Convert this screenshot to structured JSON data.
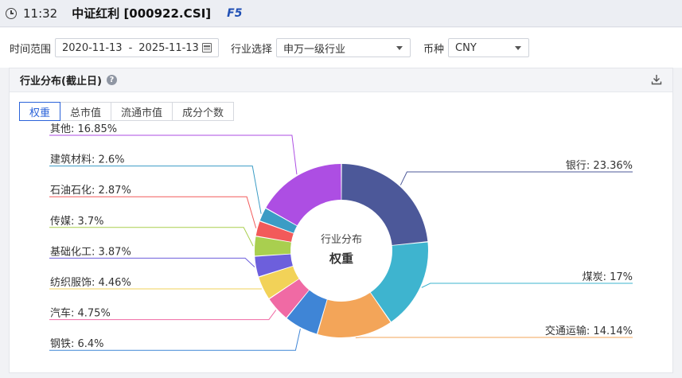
{
  "header": {
    "time": "11:32",
    "security": "中证红利 [000922.CSI]",
    "hotkey": "F5"
  },
  "filters": {
    "date_label": "时间范围",
    "date_start": "2020-11-13",
    "date_sep": "-",
    "date_end": "2025-11-13",
    "industry_label": "行业选择",
    "industry_value": "申万一级行业",
    "currency_label": "币种",
    "currency_value": "CNY"
  },
  "panel": {
    "title": "行业分布(截止日)",
    "help": "?",
    "tabs": [
      {
        "label": "权重",
        "active": true
      },
      {
        "label": "总市值",
        "active": false
      },
      {
        "label": "流通市值",
        "active": false
      },
      {
        "label": "成分个数",
        "active": false
      }
    ]
  },
  "chart_data": {
    "type": "pie",
    "center_title": "行业分布",
    "center_subtitle": "权重",
    "slices": [
      {
        "label": "银行",
        "value": 23.36,
        "text": "银行: 23.36%",
        "color": "#4c5899"
      },
      {
        "label": "煤炭",
        "value": 17,
        "text": "煤炭: 17%",
        "color": "#3eb4cf"
      },
      {
        "label": "交通运输",
        "value": 14.14,
        "text": "交通运输: 14.14%",
        "color": "#f3a559"
      },
      {
        "label": "钢铁",
        "value": 6.4,
        "text": "钢铁: 6.4%",
        "color": "#3f85d6"
      },
      {
        "label": "汽车",
        "value": 4.75,
        "text": "汽车: 4.75%",
        "color": "#f06aa4"
      },
      {
        "label": "纺织服饰",
        "value": 4.46,
        "text": "纺织服饰: 4.46%",
        "color": "#f2d258"
      },
      {
        "label": "基础化工",
        "value": 3.87,
        "text": "基础化工: 3.87%",
        "color": "#6d5fdc"
      },
      {
        "label": "传媒",
        "value": 3.7,
        "text": "传媒: 3.7%",
        "color": "#a9cf4f"
      },
      {
        "label": "石油石化",
        "value": 2.87,
        "text": "石油石化: 2.87%",
        "color": "#f25a5a"
      },
      {
        "label": "建筑材料",
        "value": 2.6,
        "text": "建筑材料: 2.6%",
        "color": "#3b9cc5"
      },
      {
        "label": "其他",
        "value": 16.85,
        "text": "其他: 16.85%",
        "color": "#ad4ee3"
      }
    ]
  }
}
